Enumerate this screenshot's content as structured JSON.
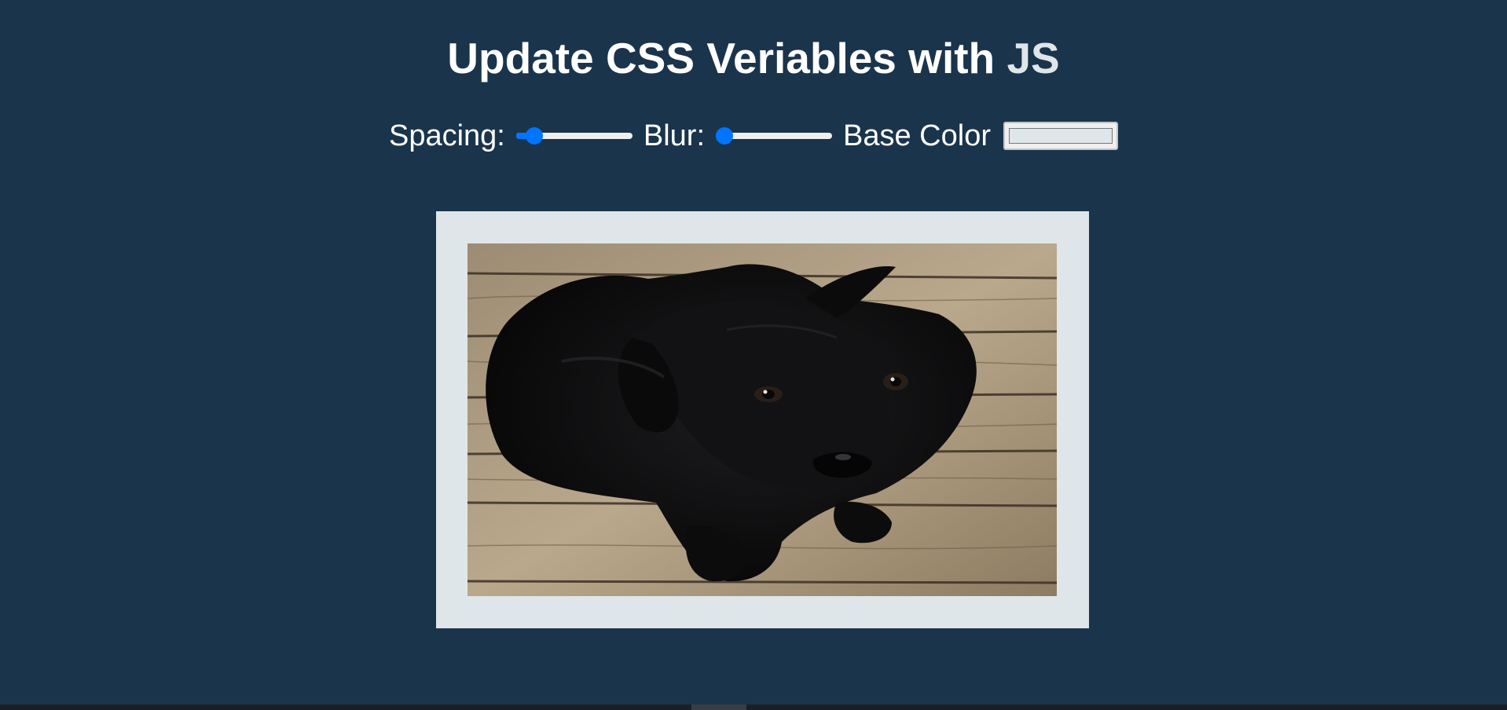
{
  "header": {
    "title_main": "Update CSS Veriables with",
    "title_highlight": "JS"
  },
  "controls": {
    "spacing_label": "Spacing:",
    "spacing_value_fraction": 0.1,
    "blur_label": "Blur:",
    "blur_value_fraction": 0,
    "base_color_label": "Base Color",
    "base_color_value": "#dfe6e9"
  },
  "image": {
    "alt": "black labrador puppy sitting on wooden floor",
    "frame_color": "#dfe6e9"
  },
  "theme": {
    "background": "#1a344c",
    "accent": "#0075ff"
  }
}
